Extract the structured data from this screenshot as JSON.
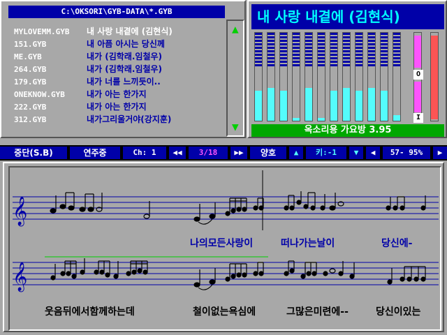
{
  "file_panel": {
    "path": "C:\\OKSORI\\GYB-DATA\\*.GYB",
    "files": [
      {
        "name": "MYLOVEMM.GYB",
        "title": "내 사랑 내곁에 (김현식)",
        "selected": true
      },
      {
        "name": "151.GYB",
        "title": "내 아픔 아시는 당신께",
        "selected": false
      },
      {
        "name": "ME.GYB",
        "title": "내가 (김학래.임철우)",
        "selected": false
      },
      {
        "name": "264.GYB",
        "title": "내가 (김학래.임철우)",
        "selected": false
      },
      {
        "name": "179.GYB",
        "title": "내가 너를 느끼듯이..",
        "selected": false
      },
      {
        "name": "ONEKNOW.GYB",
        "title": "내가 아는 한가지",
        "selected": false
      },
      {
        "name": "222.GYB",
        "title": "내가 아는 한가지",
        "selected": false
      },
      {
        "name": "312.GYB",
        "title": "내가그리울거야(강지훈)",
        "selected": false
      }
    ],
    "scroll_up": "▲",
    "scroll_down": "▼"
  },
  "spectrum": {
    "song_title": "내 사랑 내곁에 (김현식)",
    "levels": [
      0.55,
      0.6,
      0.55,
      0.05,
      0.6,
      0.05,
      0.55,
      0.6,
      0.55,
      0.6,
      0.55,
      0.1
    ],
    "side_label_top": "O",
    "side_label_bottom": "I",
    "status": "옥소리용 가요방 3.95",
    "colors": {
      "peak": "#0000a8",
      "mid": "#54fcfc",
      "pink": "#fc54fc",
      "red": "#fc5454"
    }
  },
  "controls": {
    "stop_label": "중단(S.B)",
    "playing_label": "연주중",
    "channel": "Ch: 1",
    "prev": "◀◀",
    "track": "3/18",
    "next": "▶▶",
    "quality": "양호",
    "key_up": "▲",
    "key": "키:-1",
    "key_down": "▼",
    "tempo_left": "◀",
    "tempo": "57- 95%",
    "tempo_right": "▶",
    "colors": {
      "track": "#fc54fc",
      "key": "#54fcfc"
    }
  },
  "score": {
    "lyrics_line1": [
      "나의모든사랑이",
      "떠나가는날이",
      "당신에-"
    ],
    "lyrics_line2": [
      "웃음뒤에서함께하는데",
      "철이없는욕심에",
      "그많은미련에--",
      "당신이있는"
    ]
  }
}
